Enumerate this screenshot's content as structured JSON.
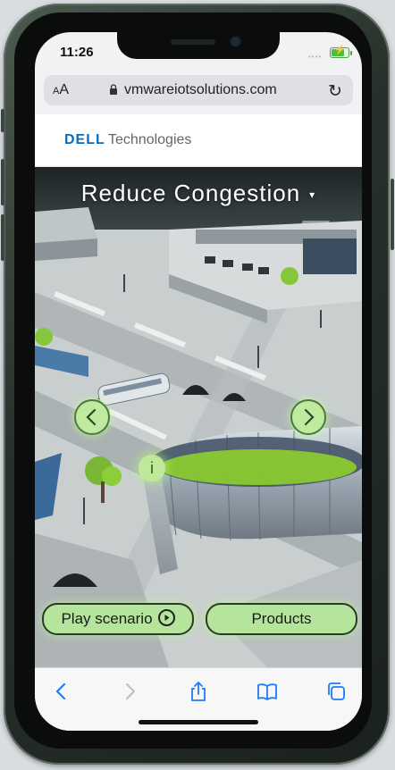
{
  "status_bar": {
    "time": "11:26",
    "signal": "••••"
  },
  "browser": {
    "text_size_label": "AA",
    "url": "vmwareiotsolutions.com"
  },
  "header": {
    "brand_bold": "DELL",
    "brand_rest": "Technologies"
  },
  "scene": {
    "title": "Reduce Congestion",
    "caret": "▾",
    "info_label": "i",
    "play_button": "Play scenario",
    "products_button": "Products"
  },
  "toolbar": {
    "icons": [
      "back-icon",
      "forward-icon",
      "share-icon",
      "bookmarks-icon",
      "tabs-icon"
    ]
  },
  "colors": {
    "accent_green": "#b5e59c",
    "dell_blue": "#0a6ebd",
    "ios_blue": "#1f7cf6"
  }
}
